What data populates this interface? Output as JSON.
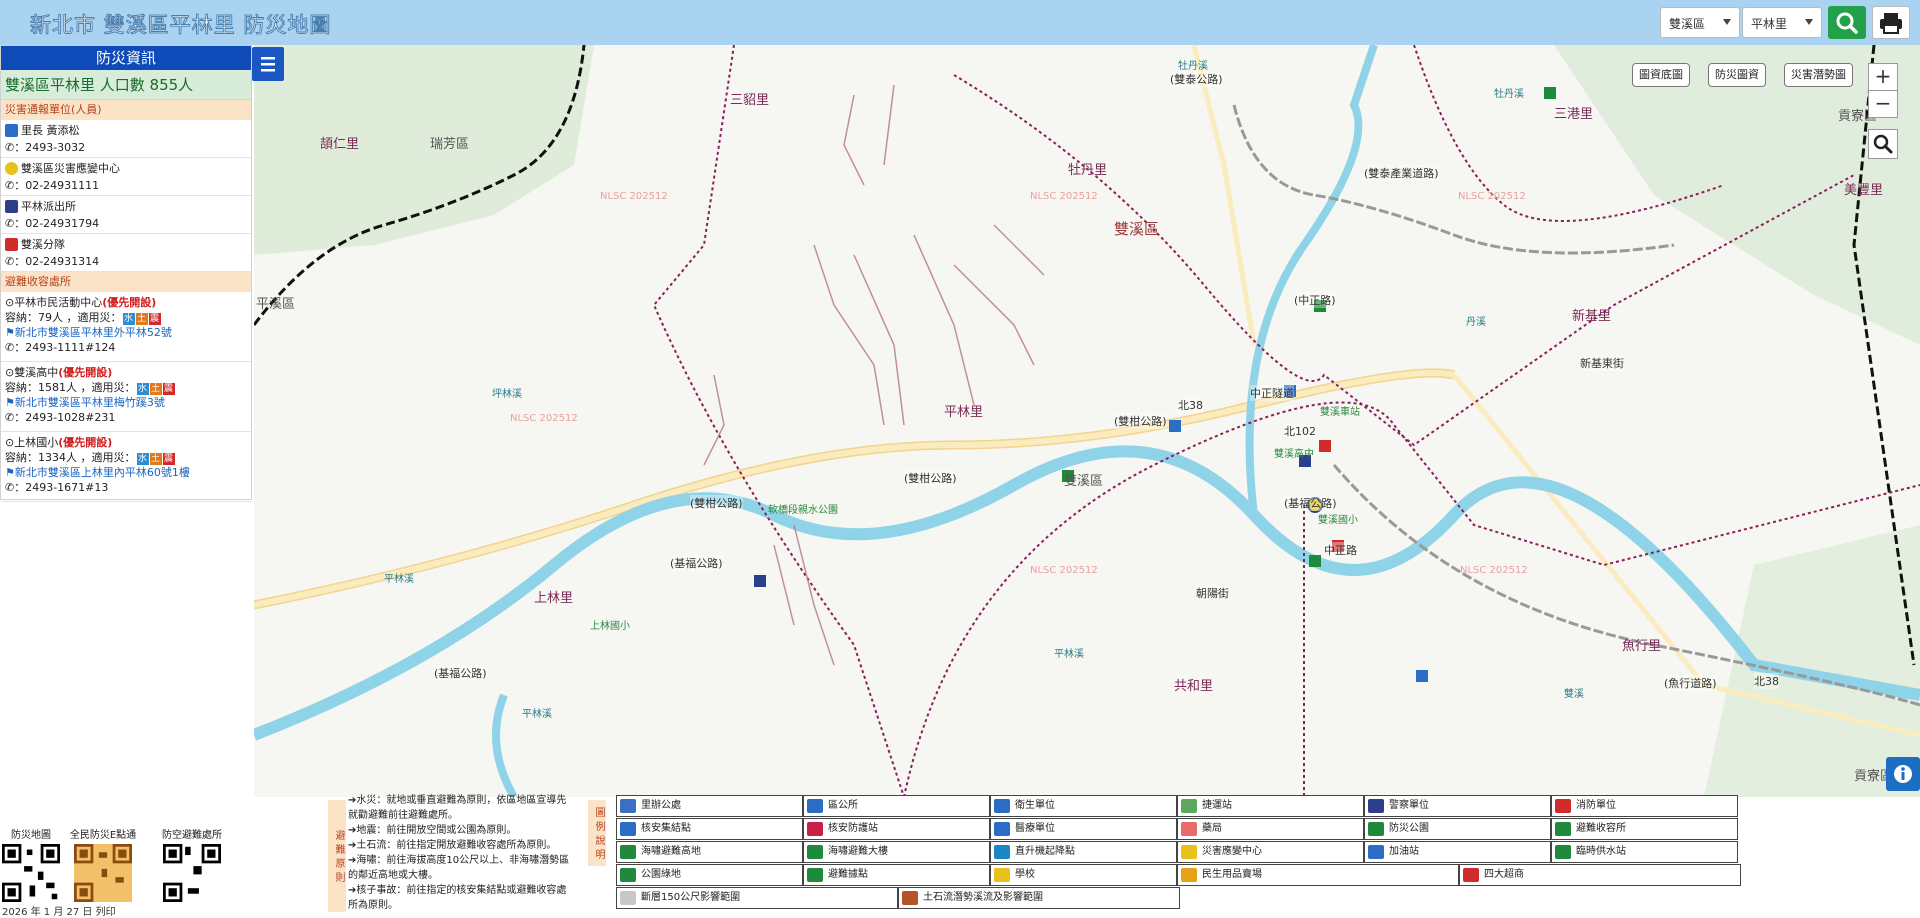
{
  "header": {
    "title": "新北市 雙溪區平林里 防災地圖",
    "district_select": "雙溪區",
    "village_select": "平林里"
  },
  "panel": {
    "title": "防災資訊",
    "village_summary": "雙溪區平林里  人口數   855人",
    "contacts_heading": "災害通報單位(人員)",
    "contacts": [
      {
        "name": "里長 黃添松",
        "phone": "：2493-3032",
        "icon": "village-chief-icon",
        "color": "#2b6cc4"
      },
      {
        "name": "雙溪區災害應變中心",
        "phone": "：02-24931111",
        "icon": "eoc-icon",
        "color": "#e8c21a"
      },
      {
        "name": "平林派出所",
        "phone": "：02-24931794",
        "icon": "police-icon",
        "color": "#2b3f8a"
      },
      {
        "name": "雙溪分隊",
        "phone": "：02-24931314",
        "icon": "fire-station-icon",
        "color": "#d22b2b"
      }
    ],
    "shelters_heading": "避難收容處所",
    "shelters": [
      {
        "name": "平林市民活動中心",
        "priority": "(優先開設)",
        "capacity": "容納：79人 ，適用災：",
        "address": "新北市雙溪區平林里外平林52號",
        "phone": "：2493-1111#124"
      },
      {
        "name": "雙溪高中",
        "priority": "(優先開設)",
        "capacity": "容納：1581人 ，適用災：",
        "address": "新北市雙溪區平林里梅竹蹊3號",
        "phone": "：2493-1028#231"
      },
      {
        "name": "上林國小",
        "priority": "(優先開設)",
        "capacity": "容納：1334人 ，適用災：",
        "address": "新北市雙溪區上林里內平林60號1樓",
        "phone": "：2493-1671#13"
      }
    ],
    "hazard_tags": [
      "水",
      "土",
      "震"
    ]
  },
  "map": {
    "buttons": [
      "圖資底圖",
      "防災圖資",
      "災害潛勢圖"
    ],
    "zoom_in": "+",
    "zoom_out": "−",
    "places": [
      {
        "t": "三貂里",
        "cls": "place"
      },
      {
        "t": "頡仁里",
        "cls": "place"
      },
      {
        "t": "瑞芳區",
        "cls": "place dist"
      },
      {
        "t": "牡丹里",
        "cls": "place"
      },
      {
        "t": "雙溪區",
        "cls": "place big"
      },
      {
        "t": "三港里",
        "cls": "place"
      },
      {
        "t": "貢寮區",
        "cls": "place dist"
      },
      {
        "t": "美豐里",
        "cls": "place"
      },
      {
        "t": "新基里",
        "cls": "place"
      },
      {
        "t": "平溪區",
        "cls": "place dist"
      },
      {
        "t": "平林里",
        "cls": "place"
      },
      {
        "t": "雙溪區",
        "cls": "place dist"
      },
      {
        "t": "上林里",
        "cls": "place"
      },
      {
        "t": "共和里",
        "cls": "place"
      },
      {
        "t": "魚行里",
        "cls": "place"
      },
      {
        "t": "貢寮區",
        "cls": "place dist"
      }
    ],
    "roads": [
      "(雙柑公路)",
      "(雙柑公路)",
      "(雙柑公路)",
      "(基福公路)",
      "(基福公路)",
      "(基福公路)",
      "(中正路)",
      "(魚行道路)",
      "中正路",
      "(雙泰產業道路)",
      "新基東街",
      "中正隧道",
      "朝陽街",
      "(雙泰公路)"
    ],
    "rivers": [
      "牡丹溪",
      "坪林溪",
      "平林溪",
      "平林溪",
      "平林溪",
      "雙溪",
      "丹溪",
      "牡丹溪"
    ],
    "watermark": "NLSC 202512",
    "pois": [
      "軟橋段親水公園",
      "上林國小",
      "雙溪國小",
      "雙溪高中",
      "雙溪車站",
      "北38",
      "北102",
      "北38"
    ]
  },
  "bottom": {
    "qr_labels": [
      "防災地圖",
      "全民防災E點通",
      "防空避難處所"
    ],
    "date": "2026 年 1 月 27 日 列印",
    "rules_tag": "避難原則",
    "rules": [
      "➔水災：就地或垂直避難為原則，依區地區宣導先就勸避難前往避難處所。",
      "➔地震：前往開放空間或公園為原則。",
      "➔土石流：前往指定開放避難收容處所為原則。",
      "➔海嘯：前往海拔高度10公尺以上、非海嘯潛勢區的鄰近高地或大樓。",
      "➔核子事故：前往指定的核安集結點或避難收容處所為原則。"
    ],
    "legend_tag": "圖例說明",
    "legend": [
      {
        "label": "里辦公處",
        "icon": "village-office-icon",
        "color": "#3a6fc4"
      },
      {
        "label": "區公所",
        "icon": "district-office-icon",
        "color": "#2b6cc4"
      },
      {
        "label": "衛生單位",
        "icon": "health-icon",
        "color": "#2b6cc4"
      },
      {
        "label": "捷運站",
        "icon": "mrt-icon",
        "color": "#5da75e"
      },
      {
        "label": "警察單位",
        "icon": "police-icon",
        "color": "#2b3f8a"
      },
      {
        "label": "消防單位",
        "icon": "fire-icon",
        "color": "#d22b2b"
      },
      {
        "label": "核安集結點",
        "icon": "nuclear-assembly-icon",
        "color": "#2b6cc4"
      },
      {
        "label": "核安防護站",
        "icon": "nuclear-station-icon",
        "color": "#c81e4a"
      },
      {
        "label": "醫療單位",
        "icon": "medical-icon",
        "color": "#2b6cc4"
      },
      {
        "label": "藥局",
        "icon": "pharmacy-icon",
        "color": "#e86a6a"
      },
      {
        "label": "防災公園",
        "icon": "disaster-park-icon",
        "color": "#1f8a3b"
      },
      {
        "label": "避難收容所",
        "icon": "shelter-icon",
        "color": "#1f8a3b"
      },
      {
        "label": "海嘯避難高地",
        "icon": "tsunami-highland-icon",
        "color": "#1f8a3b"
      },
      {
        "label": "海嘯避難大樓",
        "icon": "tsunami-building-icon",
        "color": "#1f8a3b"
      },
      {
        "label": "直升機起降點",
        "icon": "helicopter-icon",
        "color": "#1c85c7"
      },
      {
        "label": "災害應變中心",
        "icon": "eoc-icon",
        "color": "#e8c21a"
      },
      {
        "label": "加油站",
        "icon": "gas-station-icon",
        "color": "#2b6cc4"
      },
      {
        "label": "臨時供水站",
        "icon": "water-supply-icon",
        "color": "#1f8a3b"
      },
      {
        "label": "公園綠地",
        "icon": "green-space-icon",
        "color": "#1f8a3b"
      },
      {
        "label": "避難據點",
        "icon": "evacuation-point-icon",
        "color": "#1f8a3b"
      },
      {
        "label": "學校",
        "icon": "school-icon",
        "color": "#e8c21a"
      },
      {
        "label": "民生用品賣場",
        "icon": "store-icon",
        "color": "#e8a21a"
      },
      {
        "label": "四大超商",
        "icon": "convenience-store-icon",
        "color": "#d22b2b"
      },
      {
        "label": "斷層150公尺影響範圍",
        "icon": "fault-zone-swatch",
        "color": "#c8c8c8"
      },
      {
        "label": "土石流潛勢溪流及影響範圍",
        "icon": "debris-flow-swatch",
        "color": "#b5542a"
      }
    ]
  }
}
